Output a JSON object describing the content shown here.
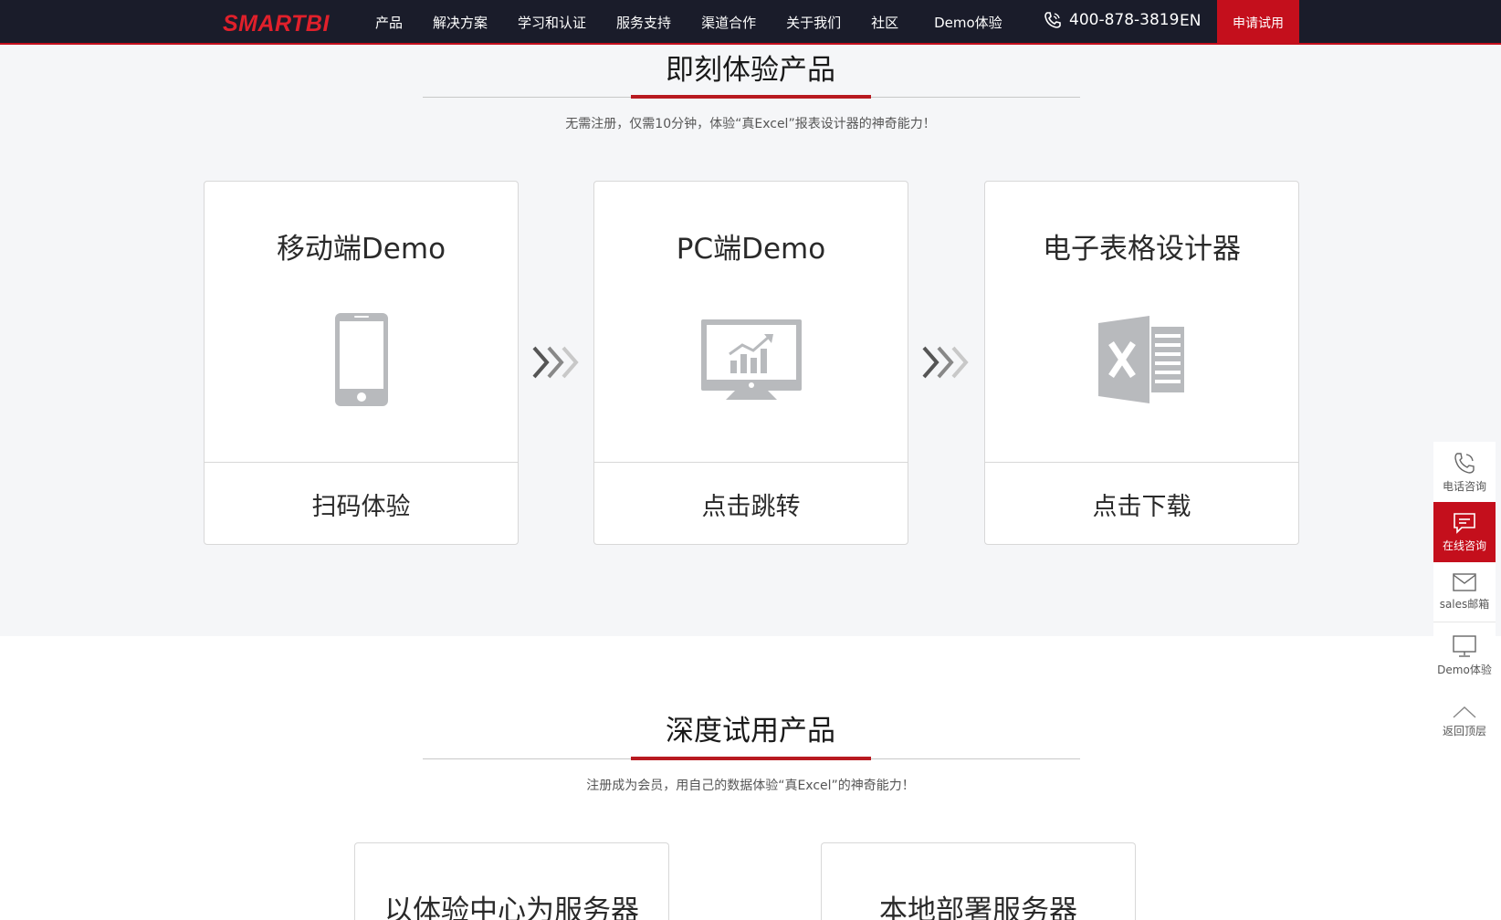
{
  "header": {
    "logo": "SMARTBI",
    "nav": [
      "产品",
      "解决方案",
      "学习和认证",
      "服务支持",
      "渠道合作",
      "关于我们",
      "社区",
      "Demo体验"
    ],
    "phone": "400-878-3819",
    "lang": "EN",
    "trial": "申请试用"
  },
  "section1": {
    "title": "即刻体验产品",
    "subtitle": "无需注册，仅需10分钟，体验“真Excel”报表设计器的神奇能力！",
    "cards": [
      {
        "title": "移动端Demo",
        "icon": "mobile-phone-icon",
        "action": "扫码体验"
      },
      {
        "title": "PC端Demo",
        "icon": "monitor-chart-icon",
        "action": "点击跳转"
      },
      {
        "title": "电子表格设计器",
        "icon": "excel-icon",
        "action": "点击下载"
      }
    ]
  },
  "section2": {
    "title": "深度试用产品",
    "subtitle": "注册成为会员，用自己的数据体验“真Excel”的神奇能力！",
    "cards": [
      {
        "title": "以体验中心为服务器"
      },
      {
        "title": "本地部署服务器"
      }
    ]
  },
  "float": [
    {
      "label": "电话咨询",
      "icon": "phone-icon"
    },
    {
      "label": "在线咨询",
      "icon": "chat-icon",
      "active": true
    },
    {
      "label": "sales邮箱",
      "icon": "mail-icon"
    },
    {
      "label": "Demo体验",
      "icon": "monitor-icon"
    },
    {
      "label": "返回顶层",
      "icon": "arrow-up-icon"
    }
  ],
  "colors": {
    "brand_red": "#c40f1c",
    "nav_bg": "#1a1c2a",
    "section_bg": "#f5f6f8"
  }
}
